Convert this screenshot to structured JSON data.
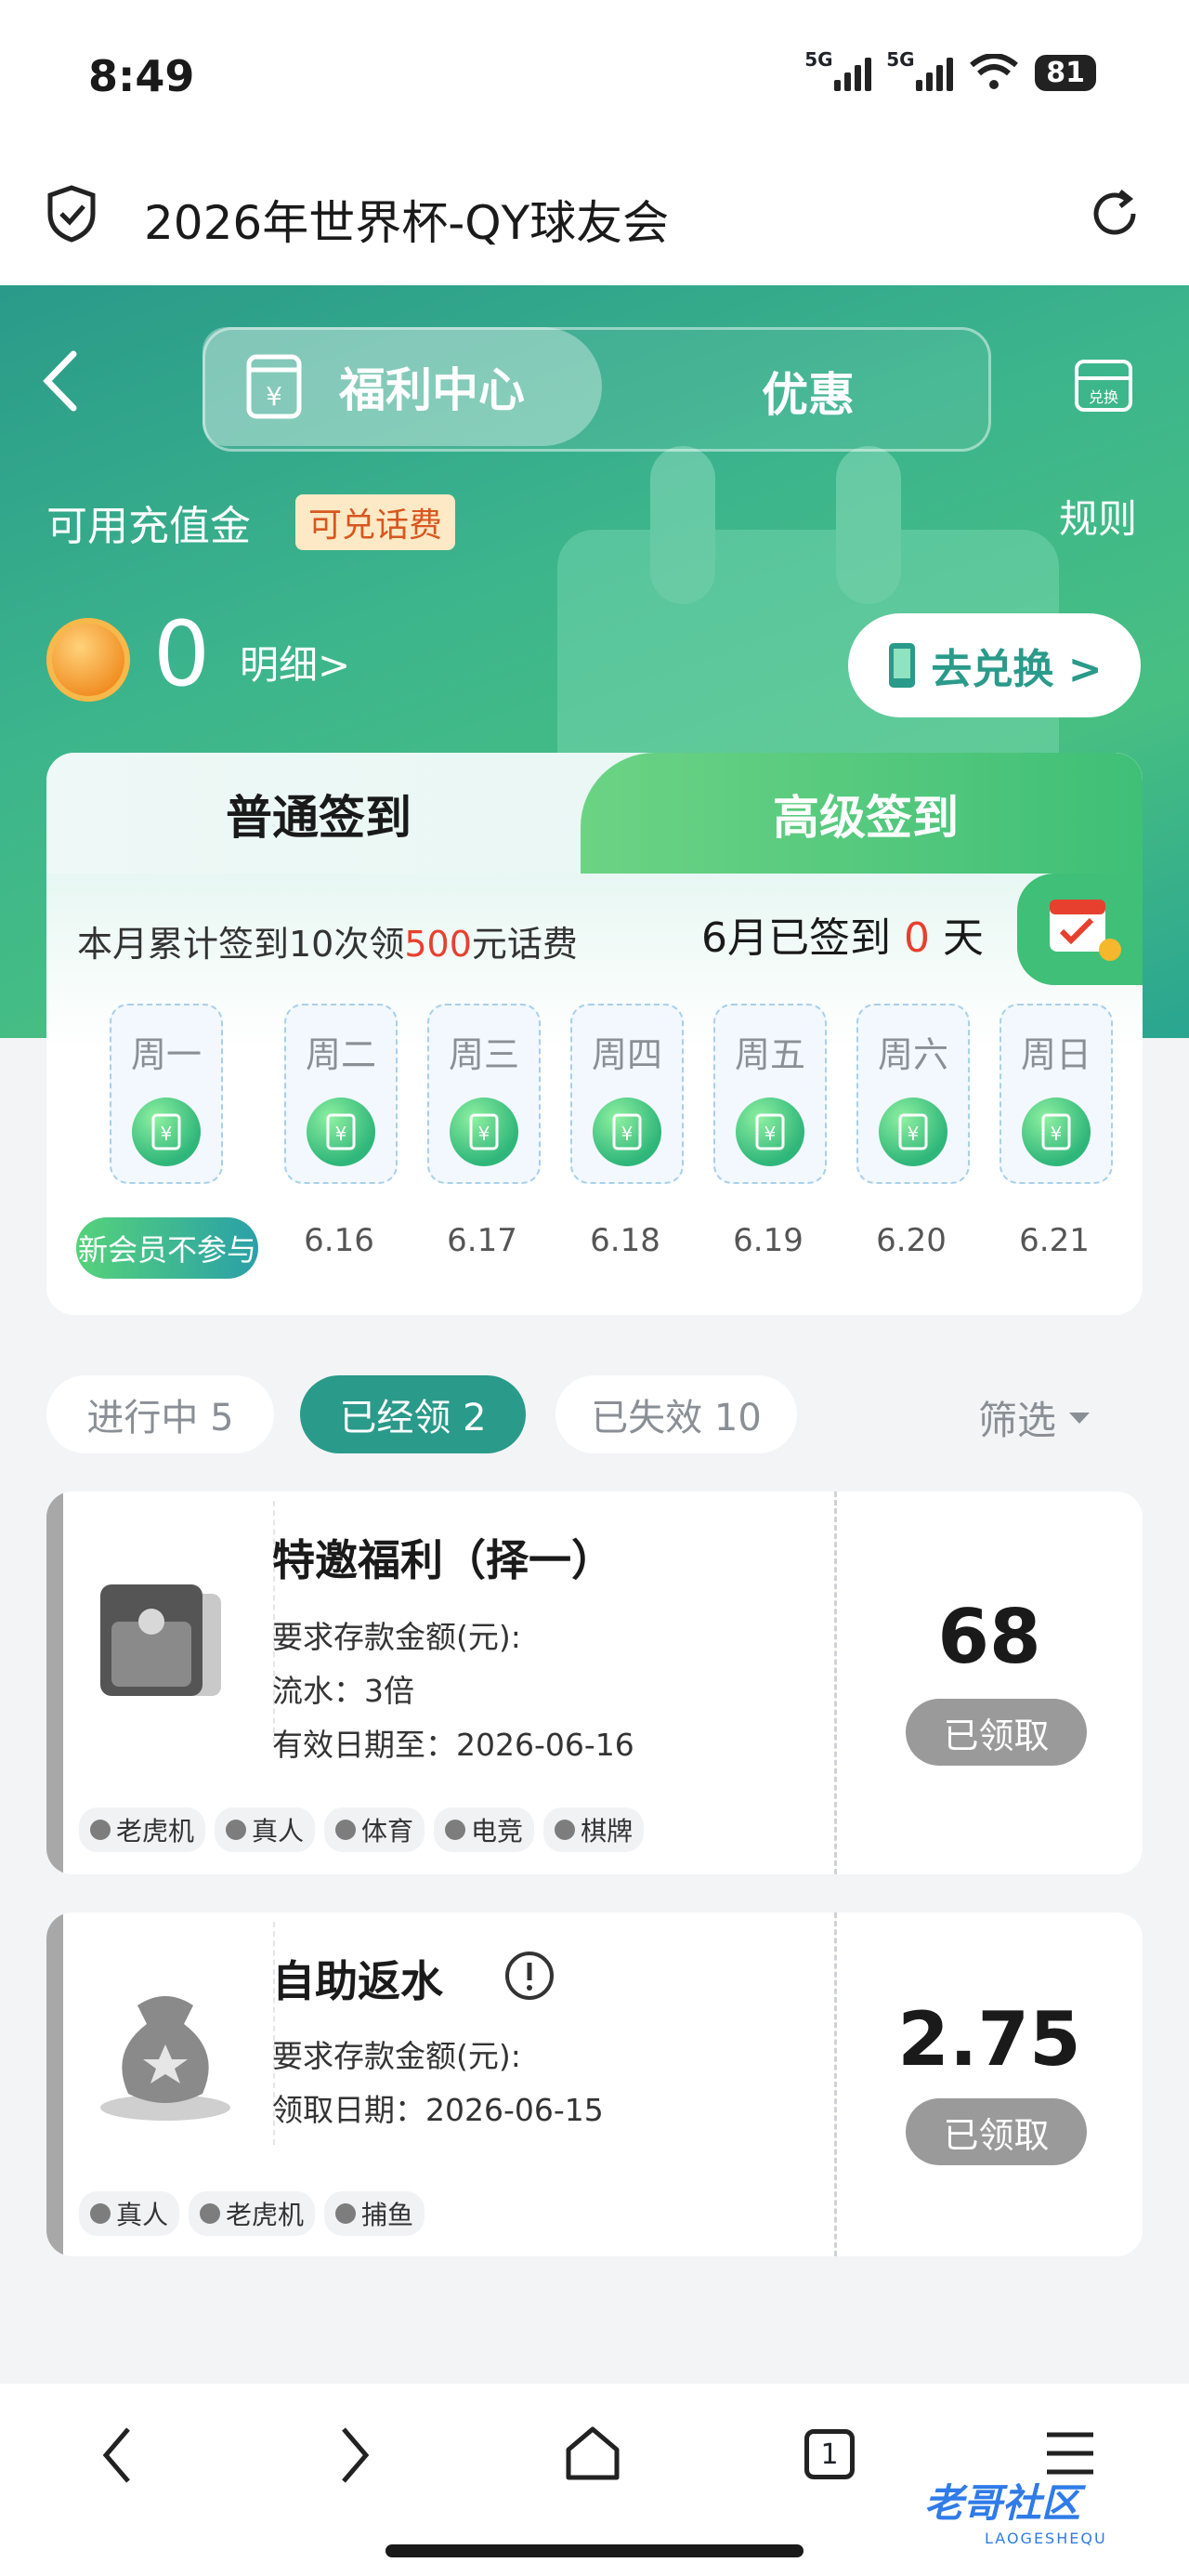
{
  "status_bar": {
    "time": "8:49",
    "signal_1": "5G",
    "signal_2": "5G",
    "battery": "81"
  },
  "address_bar": {
    "title": "2026年世界杯-QY球友会"
  },
  "header": {
    "tab_welfare": "福利中心",
    "tab_promo": "优惠",
    "redeem_icon_label": "兑换",
    "available_label": "可用充值金",
    "phone_credit_badge": "可兑话费",
    "rules": "规则",
    "balance": "0",
    "detail_link": "明细>",
    "go_redeem": "去兑换 >"
  },
  "sign_in": {
    "tab_normal": "普通签到",
    "tab_advanced": "高级签到",
    "accumulate_prefix": "本月累计签到10次领",
    "accumulate_amount": "500",
    "accumulate_suffix": "元话费",
    "signed_prefix": "6月已签到",
    "signed_days": "0",
    "signed_suffix": "天",
    "days": [
      {
        "name": "周一",
        "date": ""
      },
      {
        "name": "周二",
        "date": "6.16"
      },
      {
        "name": "周三",
        "date": "6.17"
      },
      {
        "name": "周四",
        "date": "6.18"
      },
      {
        "name": "周五",
        "date": "6.19"
      },
      {
        "name": "周六",
        "date": "6.20"
      },
      {
        "name": "周日",
        "date": "6.21"
      }
    ],
    "new_member_badge": "新会员不参与"
  },
  "filters": {
    "in_progress": "进行中  5",
    "claimed": "已经领  2",
    "expired": "已失效  10",
    "filter": "筛选"
  },
  "rewards": [
    {
      "title": "特邀福利（择一）",
      "line1": "要求存款金额(元):",
      "line2": "流水：3倍",
      "line3": "有效日期至：2026-06-16",
      "amount": "68",
      "button": "已领取",
      "tags": [
        "老虎机",
        "真人",
        "体育",
        "电竞",
        "棋牌"
      ]
    },
    {
      "title": "自助返水",
      "line1": "要求存款金额(元):",
      "line2": "领取日期：2026-06-15",
      "amount": "2.75",
      "button": "已领取",
      "tags": [
        "真人",
        "老虎机",
        "捕鱼"
      ]
    }
  ],
  "bottom_nav": {
    "tabs_count": "1"
  },
  "watermark": {
    "text": "老哥社区",
    "sub": "LAOGESHEQU"
  },
  "colors": {
    "primary": "#2a9a8a",
    "accent_red": "#e7402e",
    "claimed_gray": "#9a9a9a"
  }
}
